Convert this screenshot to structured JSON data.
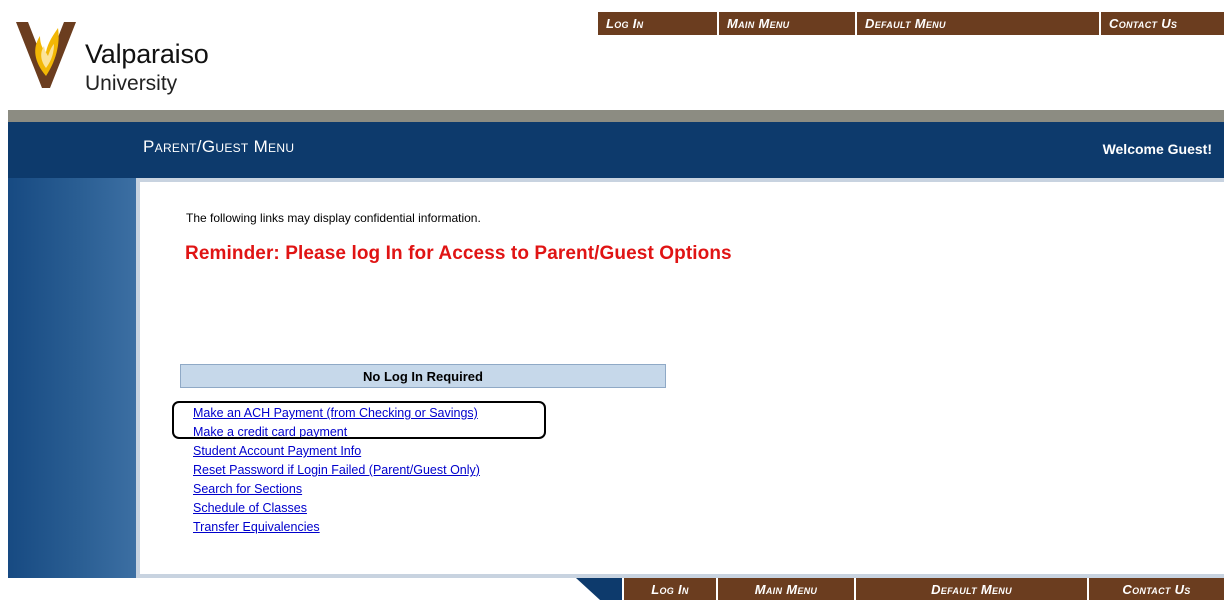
{
  "brand": {
    "name": "Valparaiso",
    "subtitle": "University"
  },
  "topnav": {
    "items": [
      {
        "label": "Log In"
      },
      {
        "label": "Main Menu"
      },
      {
        "label": "Default Menu"
      },
      {
        "label": "Contact Us"
      }
    ]
  },
  "header": {
    "title": "Parent/Guest Menu",
    "welcome": "Welcome Guest!"
  },
  "main": {
    "notice": "The following links may display confidential information.",
    "reminder": "Reminder: Please log In for Access to Parent/Guest Options",
    "section_title": "No Log In Required",
    "links": [
      "Make an ACH Payment (from Checking or Savings)",
      "Make a credit card payment",
      "Student Account Payment Info",
      "Reset Password if Login Failed (Parent/Guest Only)",
      "Search for Sections",
      "Schedule of Classes",
      "Transfer Equivalencies"
    ]
  },
  "bottomnav": {
    "items": [
      {
        "label": "Log In"
      },
      {
        "label": "Main Menu"
      },
      {
        "label": "Default Menu"
      },
      {
        "label": "Contact Us"
      }
    ]
  },
  "colors": {
    "nav_brown": "#6b3d1f",
    "header_blue": "#0d3a6c",
    "reminder_red": "#e01414",
    "link_blue": "#0000cc",
    "logo_gold": "#f2b705"
  },
  "icons": [
    "valpo-logo-mark"
  ]
}
